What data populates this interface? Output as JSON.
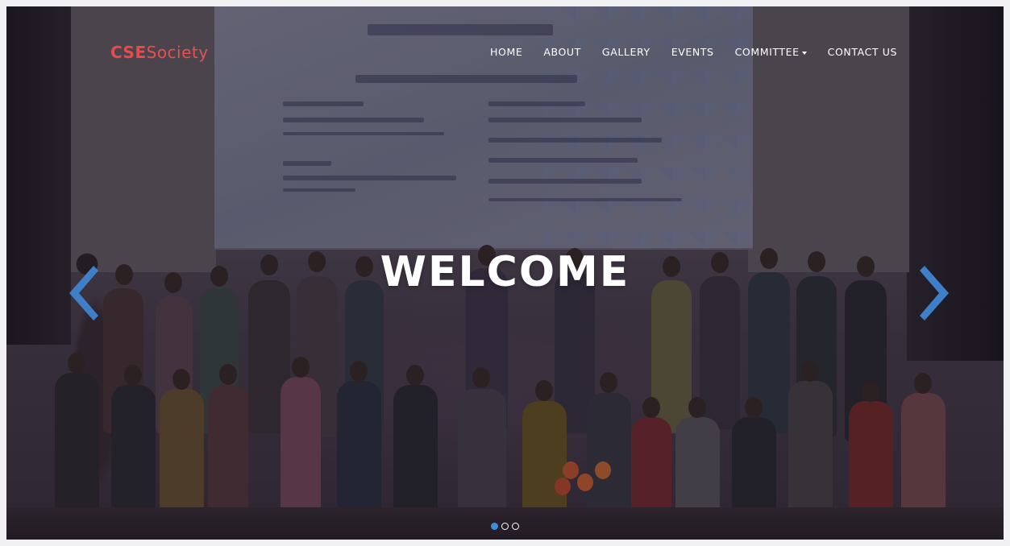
{
  "navbar": {
    "brand": {
      "part1": "CSE",
      "part2": "Society"
    },
    "items": [
      {
        "label": "HOME"
      },
      {
        "label": "ABOUT"
      },
      {
        "label": "GALLERY"
      },
      {
        "label": "EVENTS"
      },
      {
        "label": "COMMITTEE",
        "dropdown": true
      },
      {
        "label": "CONTACT US"
      }
    ]
  },
  "hero": {
    "headline": "WELCOME",
    "indicators": {
      "count": 3,
      "active": 0
    }
  },
  "colors": {
    "brand_red": "#e84b4b",
    "arrow_blue": "#3f7fc8",
    "indicator_active": "#3b8fe0",
    "nav_text": "#ffffff"
  },
  "icons": {
    "prev": "chevron-left-icon",
    "next": "chevron-right-icon",
    "dropdown": "caret-down-icon"
  }
}
